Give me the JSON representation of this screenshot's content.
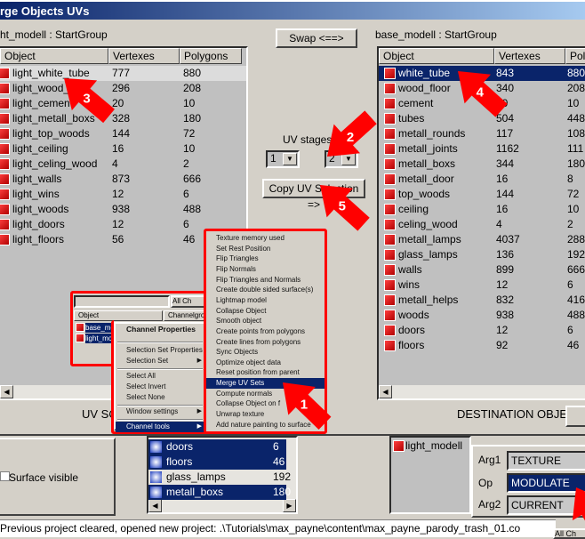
{
  "window": {
    "title": "rge Objects UVs"
  },
  "left": {
    "label": "ht_modell : StartGroup",
    "columns": [
      "Object",
      "Vertexes",
      "Polygons"
    ],
    "rows": [
      [
        "light_white_tube",
        "777",
        "880"
      ],
      [
        "light_wood_",
        "296",
        "208"
      ],
      [
        "light_cement",
        "20",
        "10"
      ],
      [
        "light_metall_boxs",
        "328",
        "180"
      ],
      [
        "light_top_woods",
        "144",
        "72"
      ],
      [
        "light_ceiling",
        "16",
        "10"
      ],
      [
        "light_celing_wood",
        "4",
        "2"
      ],
      [
        "light_walls",
        "873",
        "666"
      ],
      [
        "light_wins",
        "12",
        "6"
      ],
      [
        "light_woods",
        "938",
        "488"
      ],
      [
        "light_doors",
        "12",
        "6"
      ],
      [
        "light_floors",
        "56",
        "46"
      ]
    ]
  },
  "right": {
    "label": "base_modell : StartGroup",
    "columns": [
      "Object",
      "Vertexes",
      "Polygons"
    ],
    "rows": [
      [
        "white_tube",
        "843",
        "880"
      ],
      [
        "wood_floor",
        "340",
        "208"
      ],
      [
        "cement",
        "20",
        "10"
      ],
      [
        "tubes",
        "504",
        "448"
      ],
      [
        "metall_rounds",
        "117",
        "108"
      ],
      [
        "metall_joints",
        "1162",
        "111"
      ],
      [
        "metall_boxs",
        "344",
        "180"
      ],
      [
        "metall_door",
        "16",
        "8"
      ],
      [
        "top_woods",
        "144",
        "72"
      ],
      [
        "ceiling",
        "16",
        "10"
      ],
      [
        "celing_wood",
        "4",
        "2"
      ],
      [
        "metall_lamps",
        "4037",
        "288"
      ],
      [
        "glass_lamps",
        "136",
        "192"
      ],
      [
        "walls",
        "899",
        "666"
      ],
      [
        "wins",
        "12",
        "6"
      ],
      [
        "metall_helps",
        "832",
        "416"
      ],
      [
        "woods",
        "938",
        "488"
      ],
      [
        "doors",
        "12",
        "6"
      ],
      [
        "floors",
        "92",
        "46"
      ]
    ]
  },
  "middle": {
    "swap": "Swap <==>",
    "uv_stages_label": "UV stages:",
    "uv_source_stage": "1",
    "uv_dest_stage": "2",
    "copy": "Copy UV Selection =>"
  },
  "source_label": "UV SO",
  "dest_label": "DESTINATION OBJECT",
  "inset": {
    "filter": "All Ch",
    "columns": [
      "Object",
      "Channelgrou"
    ],
    "rows": [
      "base_mo",
      "light_mo"
    ]
  },
  "context_menu": {
    "title": "Channel Properties",
    "items": [
      "Selection Set Properties",
      "Selection Set",
      "Select All",
      "Select Invert",
      "Select None",
      "Window settings",
      "Channel tools"
    ]
  },
  "submenu": {
    "items": [
      "Texture memory used",
      "Set Rest Position",
      "Flip Triangles",
      "Flip Normals",
      "Flip Triangles and Normals",
      "Create double sided surface(s)",
      "Lightmap model",
      "Collapse Object",
      "Smooth object",
      "Create points from polygons",
      "Create lines from polygons",
      "Sync Objects",
      "Optimize object data",
      "Reset position from parent",
      "Merge UV Sets",
      "Compute normals",
      "Collapse Object on f",
      "Unwrap texture",
      "Add nature painting to surface"
    ],
    "selected": "Merge UV Sets"
  },
  "bottom": {
    "surface_visible": "Surface visible",
    "list": [
      [
        "doors",
        "6"
      ],
      [
        "floors",
        "46"
      ],
      [
        "glass_lamps",
        "192"
      ],
      [
        "metall_boxs",
        "180"
      ]
    ],
    "tree_item": "light_modell",
    "arg1_label": "Arg1",
    "arg1": "TEXTURE",
    "op_label": "Op",
    "op": "MODULATE",
    "arg2_label": "Arg2",
    "arg2": "CURRENT",
    "tab": "All Ch"
  },
  "status": "Previous project cleared, opened new project: .\\Tutorials\\max_payne\\content\\max_payne_parody_trash_01.co",
  "annotations": [
    "1",
    "2",
    "3",
    "4",
    "5"
  ],
  "colors": {
    "selection": "#0a246a",
    "arrow": "#ff0000",
    "face": "#d4d0c8"
  }
}
